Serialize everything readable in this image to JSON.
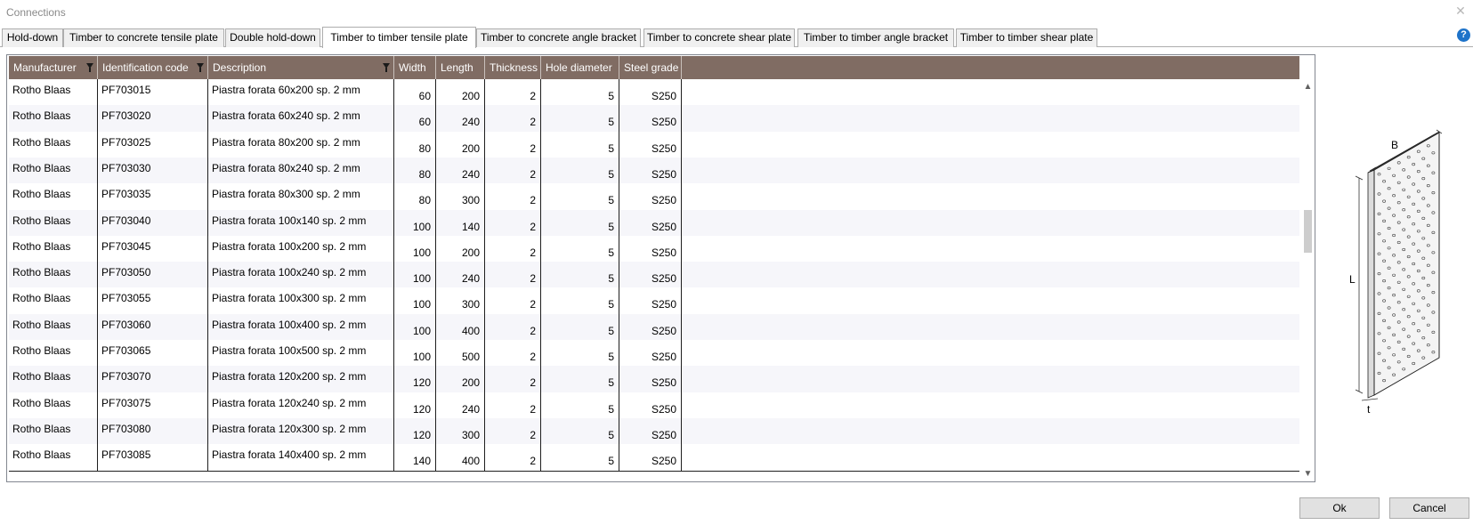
{
  "window": {
    "title": "Connections",
    "close_symbol": "✕"
  },
  "tabs": [
    {
      "label": "Hold-down",
      "active": false
    },
    {
      "label": "Timber to concrete tensile plate",
      "active": false
    },
    {
      "label": "Double hold-down",
      "active": false
    },
    {
      "label": "Timber to timber tensile plate",
      "active": true
    },
    {
      "label": "Timber to concrete angle bracket",
      "active": false
    },
    {
      "label": "Timber to concrete shear plate",
      "active": false
    },
    {
      "label": "Timber to timber angle bracket",
      "active": false
    },
    {
      "label": "Timber to timber shear plate",
      "active": false
    }
  ],
  "help_symbol": "?",
  "grid": {
    "columns": [
      {
        "label": "Manufacturer",
        "filter": true
      },
      {
        "label": "Identification code",
        "filter": true
      },
      {
        "label": "Description",
        "filter": true
      },
      {
        "label": "Width",
        "filter": false
      },
      {
        "label": "Length",
        "filter": false
      },
      {
        "label": "Thickness",
        "filter": false
      },
      {
        "label": "Hole diameter",
        "filter": false
      },
      {
        "label": "Steel grade",
        "filter": false
      }
    ],
    "rows": [
      [
        "Rotho Blaas",
        "PF703015",
        "Piastra forata 60x200 sp. 2 mm",
        "60",
        "200",
        "2",
        "5",
        "S250"
      ],
      [
        "Rotho Blaas",
        "PF703020",
        "Piastra forata 60x240 sp. 2 mm",
        "60",
        "240",
        "2",
        "5",
        "S250"
      ],
      [
        "Rotho Blaas",
        "PF703025",
        "Piastra forata 80x200 sp. 2 mm",
        "80",
        "200",
        "2",
        "5",
        "S250"
      ],
      [
        "Rotho Blaas",
        "PF703030",
        "Piastra forata 80x240 sp. 2 mm",
        "80",
        "240",
        "2",
        "5",
        "S250"
      ],
      [
        "Rotho Blaas",
        "PF703035",
        "Piastra forata 80x300 sp. 2 mm",
        "80",
        "300",
        "2",
        "5",
        "S250"
      ],
      [
        "Rotho Blaas",
        "PF703040",
        "Piastra forata 100x140 sp. 2 mm",
        "100",
        "140",
        "2",
        "5",
        "S250"
      ],
      [
        "Rotho Blaas",
        "PF703045",
        "Piastra forata 100x200 sp. 2 mm",
        "100",
        "200",
        "2",
        "5",
        "S250"
      ],
      [
        "Rotho Blaas",
        "PF703050",
        "Piastra forata 100x240 sp. 2 mm",
        "100",
        "240",
        "2",
        "5",
        "S250"
      ],
      [
        "Rotho Blaas",
        "PF703055",
        "Piastra forata 100x300 sp. 2 mm",
        "100",
        "300",
        "2",
        "5",
        "S250"
      ],
      [
        "Rotho Blaas",
        "PF703060",
        "Piastra forata 100x400 sp. 2 mm",
        "100",
        "400",
        "2",
        "5",
        "S250"
      ],
      [
        "Rotho Blaas",
        "PF703065",
        "Piastra forata 100x500 sp. 2 mm",
        "100",
        "500",
        "2",
        "5",
        "S250"
      ],
      [
        "Rotho Blaas",
        "PF703070",
        "Piastra forata 120x200 sp. 2 mm",
        "120",
        "200",
        "2",
        "5",
        "S250"
      ],
      [
        "Rotho Blaas",
        "PF703075",
        "Piastra forata 120x240 sp. 2 mm",
        "120",
        "240",
        "2",
        "5",
        "S250"
      ],
      [
        "Rotho Blaas",
        "PF703080",
        "Piastra forata 120x300 sp. 2 mm",
        "120",
        "300",
        "2",
        "5",
        "S250"
      ],
      [
        "Rotho Blaas",
        "PF703085",
        "Piastra forata 140x400 sp. 2 mm",
        "140",
        "400",
        "2",
        "5",
        "S250"
      ]
    ],
    "scroll_up_symbol": "▲",
    "scroll_down_symbol": "▼",
    "scroll_position": 0.35
  },
  "diagram": {
    "label_width": "B",
    "label_length": "L",
    "label_thickness": "t"
  },
  "buttons": {
    "ok": "Ok",
    "cancel": "Cancel"
  }
}
